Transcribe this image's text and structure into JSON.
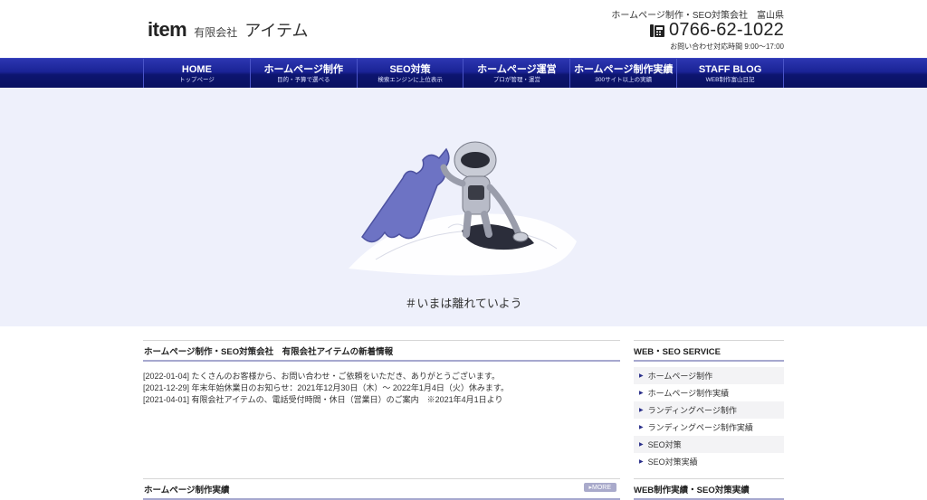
{
  "header": {
    "logo_mark": "item",
    "company_type": "有限会社",
    "company_name": "アイテム",
    "tagline": "ホームページ制作・SEO対策会社　富山県",
    "phone": "0766-62-1022",
    "phone_hours": "お問い合わせ対応時間 9:00～17:00"
  },
  "nav": [
    {
      "label": "HOME",
      "sub": "トップページ"
    },
    {
      "label": "ホームページ制作",
      "sub": "目的・予算で選べる"
    },
    {
      "label": "SEO対策",
      "sub": "検索エンジンに上位表示"
    },
    {
      "label": "ホームページ運営",
      "sub": "プロが管理・運営"
    },
    {
      "label": "ホームページ制作実績",
      "sub": "300サイト以上の実績"
    },
    {
      "label": "STAFF BLOG",
      "sub": "WEB制作富山日記"
    }
  ],
  "hero": {
    "caption": "＃いまは離れていよう"
  },
  "news": {
    "title": "ホームページ制作・SEO対策会社　有限会社アイテムの新着情報",
    "items": [
      "[2022-01-04] たくさんのお客様から、お問い合わせ・ご依頼をいただき、ありがとうございます。",
      "[2021-12-29] 年末年始休業日のお知らせ：2021年12月30日（木）～ 2022年1月4日（火）休みます。",
      "[2021-04-01] 有限会社アイテムの、電話受付時間・休日（営業日）のご案内　※2021年4月1日より"
    ]
  },
  "works": {
    "title": "ホームページ制作実績",
    "more": "▸MORE"
  },
  "sidebar": {
    "title": "WEB・SEO SERVICE",
    "items": [
      "ホームページ制作",
      "ホームページ制作実績",
      "ランディングページ制作",
      "ランディングページ制作実績",
      "SEO対策",
      "SEO対策実績"
    ],
    "title2": "WEB制作実績・SEO対策実績"
  },
  "colors": {
    "nav_blue": "#1a2396",
    "hero_bg": "#eef0fb",
    "accent_line": "#a6a8cf"
  }
}
